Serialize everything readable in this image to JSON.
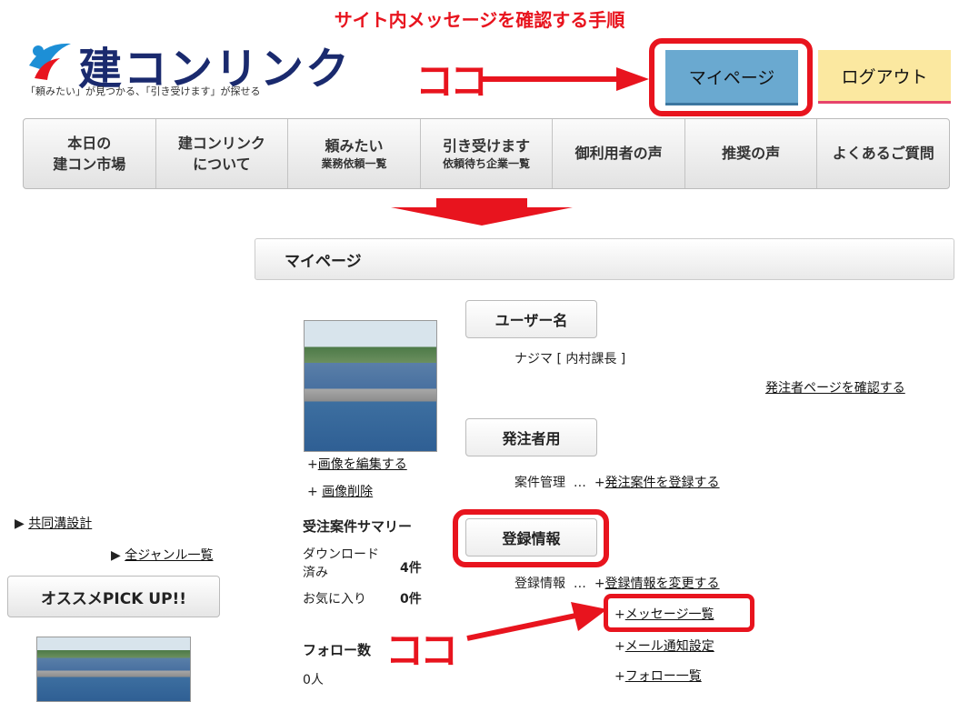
{
  "guide_title": "サイト内メッセージを確認する手順",
  "logo": {
    "text": "建コンリンク",
    "tagline": "「頼みたい」が見つかる、「引き受けます」が探せる"
  },
  "header": {
    "mypage_label": "マイページ",
    "logout_label": "ログアウト"
  },
  "annotation": {
    "here_label": "ココ",
    "here_label_2": "ココ",
    "accent_color": "#e8141e"
  },
  "nav": [
    {
      "line1": "本日の",
      "line2": "建コン市場"
    },
    {
      "line1": "建コンリンク",
      "line2": "について"
    },
    {
      "line1": "頼みたい",
      "line2": "業務依頼一覧"
    },
    {
      "line1": "引き受けます",
      "line2": "依頼待ち企業一覧"
    },
    {
      "line1": "御利用者の声",
      "line2": ""
    },
    {
      "line1": "推奨の声",
      "line2": ""
    },
    {
      "line1": "よくあるご質問",
      "line2": ""
    }
  ],
  "mypage": {
    "section_title": "マイページ",
    "image_edit": "画像を編集する",
    "image_delete": "画像削除",
    "summary_title": "受注案件サマリー",
    "downloaded_label": "ダウンロード済み",
    "downloaded_count": "4件",
    "favorites_label": "お気に入り",
    "favorites_count": "0件",
    "follow_title": "フォロー数",
    "follow_count": "0人",
    "username_heading": "ユーザー名",
    "username_value": "ナジマ [ 内村課長 ]",
    "orderer_page_link": "発注者ページを確認する",
    "orderer_heading": "発注者用",
    "case_mgmt_label": "案件管理",
    "register_case_link": "発注案件を登録する",
    "reg_info_heading": "登録情報",
    "reg_info_label": "登録情報",
    "change_info_link": "登録情報を変更する",
    "message_list_link": "メッセージ一覧",
    "mail_setting_link": "メール通知設定",
    "follow_list_link": "フォロー一覧",
    "ellipsis": "…",
    "plus": "+"
  },
  "sidebar": {
    "joint_design": "共同溝設計",
    "all_genres": "全ジャンル一覧",
    "pickup": "オススメPICK UP!!",
    "arrow": "▶"
  }
}
